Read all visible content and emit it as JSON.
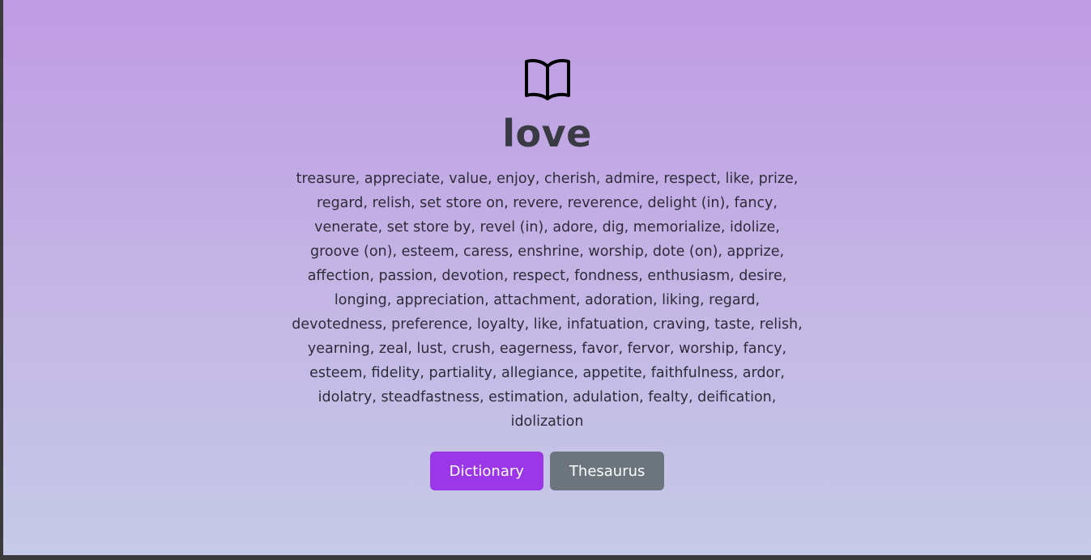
{
  "entry": {
    "word": "love",
    "synonyms": "treasure, appreciate, value, enjoy, cherish, admire, respect, like, prize, regard, relish, set store on, revere, reverence, delight (in), fancy, venerate, set store by, revel (in), adore, dig, memorialize, idolize, groove (on), esteem, caress, enshrine, worship, dote (on), apprize, affection, passion, devotion, respect, fondness, enthusiasm, desire, longing, appreciation, attachment, adoration, liking, regard, devotedness, preference, loyalty, like, infatuation, craving, taste, relish, yearning, zeal, lust, crush, eagerness, favor, fervor, worship, fancy, esteem, fidelity, partiality, allegiance, appetite, faithfulness, ardor, idolatry, steadfastness, estimation, adulation, fealty, deification, idolization"
  },
  "buttons": {
    "dictionary_label": "Dictionary",
    "thesaurus_label": "Thesaurus"
  },
  "icons": {
    "header": "open-book-icon"
  },
  "colors": {
    "dictionary_button": "#9b37e6",
    "thesaurus_button": "#6c757d",
    "gradient_top": "#bf9be3",
    "gradient_bottom": "#c6cae8"
  }
}
